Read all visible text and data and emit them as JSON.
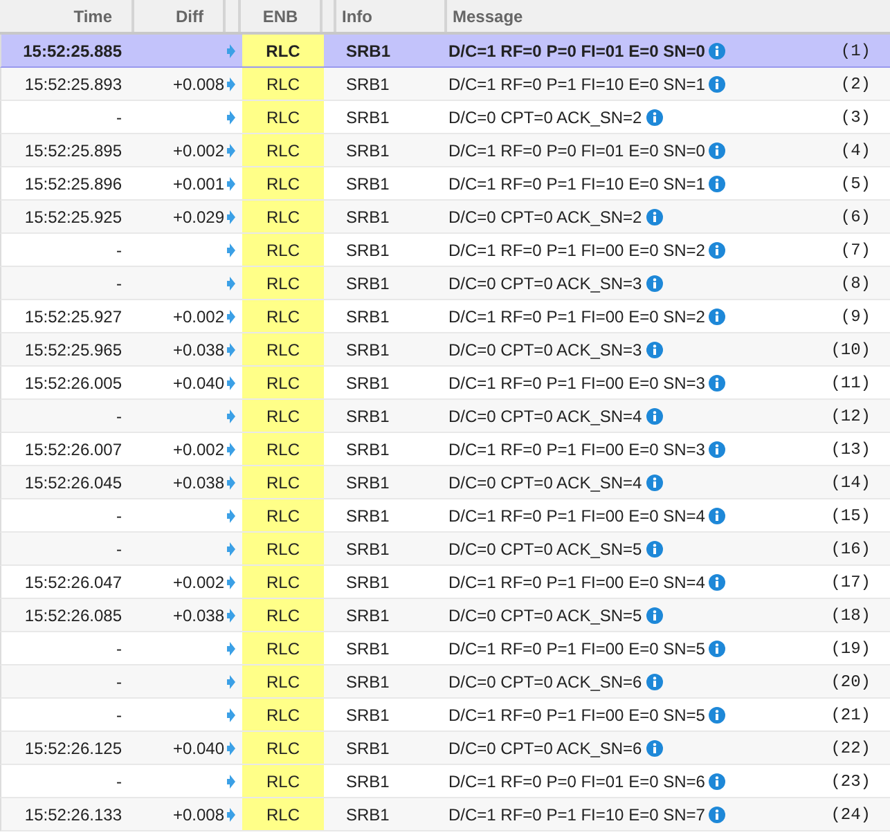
{
  "columns": [
    "Time",
    "Diff",
    "ENB",
    "Info",
    "Message"
  ],
  "rows": [
    {
      "time": "15:52:25.885",
      "enb": "RLC",
      "info": "SRB1",
      "message": "D/C=1 RF=0 P=0 FI=01 E=0 SN=0",
      "index": "(1)",
      "selected": true
    },
    {
      "time": "15:52:25.893",
      "diff": "+0.008",
      "enb": "RLC",
      "info": "SRB1",
      "message": "D/C=1 RF=0 P=1 FI=10 E=0 SN=1",
      "index": "(2)",
      "selected": false
    },
    {
      "time": "-",
      "enb": "RLC",
      "info": "SRB1",
      "message": "D/C=0 CPT=0 ACK_SN=2",
      "index": "(3)",
      "selected": false
    },
    {
      "time": "15:52:25.895",
      "diff": "+0.002",
      "enb": "RLC",
      "info": "SRB1",
      "message": "D/C=1 RF=0 P=0 FI=01 E=0 SN=0",
      "index": "(4)",
      "selected": false
    },
    {
      "time": "15:52:25.896",
      "diff": "+0.001",
      "enb": "RLC",
      "info": "SRB1",
      "message": "D/C=1 RF=0 P=1 FI=10 E=0 SN=1",
      "index": "(5)",
      "selected": false
    },
    {
      "time": "15:52:25.925",
      "diff": "+0.029",
      "enb": "RLC",
      "info": "SRB1",
      "message": "D/C=0 CPT=0 ACK_SN=2",
      "index": "(6)",
      "selected": false
    },
    {
      "time": "-",
      "enb": "RLC",
      "info": "SRB1",
      "message": "D/C=1 RF=0 P=1 FI=00 E=0 SN=2",
      "index": "(7)",
      "selected": false
    },
    {
      "time": "-",
      "enb": "RLC",
      "info": "SRB1",
      "message": "D/C=0 CPT=0 ACK_SN=3",
      "index": "(8)",
      "selected": false
    },
    {
      "time": "15:52:25.927",
      "diff": "+0.002",
      "enb": "RLC",
      "info": "SRB1",
      "message": "D/C=1 RF=0 P=1 FI=00 E=0 SN=2",
      "index": "(9)",
      "selected": false
    },
    {
      "time": "15:52:25.965",
      "diff": "+0.038",
      "enb": "RLC",
      "info": "SRB1",
      "message": "D/C=0 CPT=0 ACK_SN=3",
      "index": "(10)",
      "selected": false
    },
    {
      "time": "15:52:26.005",
      "diff": "+0.040",
      "enb": "RLC",
      "info": "SRB1",
      "message": "D/C=1 RF=0 P=1 FI=00 E=0 SN=3",
      "index": "(11)",
      "selected": false
    },
    {
      "time": "-",
      "enb": "RLC",
      "info": "SRB1",
      "message": "D/C=0 CPT=0 ACK_SN=4",
      "index": "(12)",
      "selected": false
    },
    {
      "time": "15:52:26.007",
      "diff": "+0.002",
      "enb": "RLC",
      "info": "SRB1",
      "message": "D/C=1 RF=0 P=1 FI=00 E=0 SN=3",
      "index": "(13)",
      "selected": false
    },
    {
      "time": "15:52:26.045",
      "diff": "+0.038",
      "enb": "RLC",
      "info": "SRB1",
      "message": "D/C=0 CPT=0 ACK_SN=4",
      "index": "(14)",
      "selected": false
    },
    {
      "time": "-",
      "enb": "RLC",
      "info": "SRB1",
      "message": "D/C=1 RF=0 P=1 FI=00 E=0 SN=4",
      "index": "(15)",
      "selected": false
    },
    {
      "time": "-",
      "enb": "RLC",
      "info": "SRB1",
      "message": "D/C=0 CPT=0 ACK_SN=5",
      "index": "(16)",
      "selected": false
    },
    {
      "time": "15:52:26.047",
      "diff": "+0.002",
      "enb": "RLC",
      "info": "SRB1",
      "message": "D/C=1 RF=0 P=1 FI=00 E=0 SN=4",
      "index": "(17)",
      "selected": false
    },
    {
      "time": "15:52:26.085",
      "diff": "+0.038",
      "enb": "RLC",
      "info": "SRB1",
      "message": "D/C=0 CPT=0 ACK_SN=5",
      "index": "(18)",
      "selected": false
    },
    {
      "time": "-",
      "enb": "RLC",
      "info": "SRB1",
      "message": "D/C=1 RF=0 P=1 FI=00 E=0 SN=5",
      "index": "(19)",
      "selected": false
    },
    {
      "time": "-",
      "enb": "RLC",
      "info": "SRB1",
      "message": "D/C=0 CPT=0 ACK_SN=6",
      "index": "(20)",
      "selected": false
    },
    {
      "time": "-",
      "enb": "RLC",
      "info": "SRB1",
      "message": "D/C=1 RF=0 P=1 FI=00 E=0 SN=5",
      "index": "(21)",
      "selected": false
    },
    {
      "time": "15:52:26.125",
      "diff": "+0.040",
      "enb": "RLC",
      "info": "SRB1",
      "message": "D/C=0 CPT=0 ACK_SN=6",
      "index": "(22)",
      "selected": false
    },
    {
      "time": "-",
      "enb": "RLC",
      "info": "SRB1",
      "message": "D/C=1 RF=0 P=0 FI=01 E=0 SN=6",
      "index": "(23)",
      "selected": false
    },
    {
      "time": "15:52:26.133",
      "diff": "+0.008",
      "enb": "RLC",
      "info": "SRB1",
      "message": "D/C=1 RF=0 P=1 FI=10 E=0 SN=7",
      "index": "(24)",
      "selected": false
    }
  ]
}
